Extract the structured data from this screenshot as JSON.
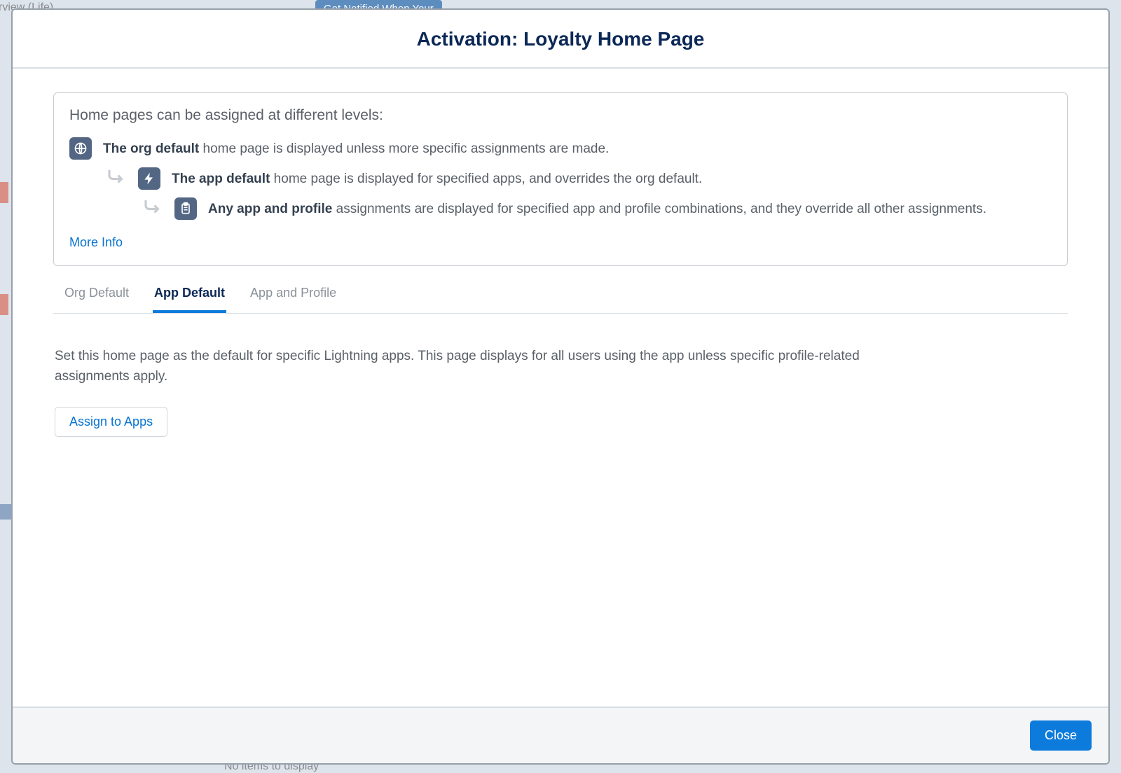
{
  "backdrop": {
    "top_left": "rview (Life)",
    "top_pill": "Get Notified When Your",
    "bottom_center": "No items to display"
  },
  "modal": {
    "title": "Activation: Loyalty Home Page"
  },
  "info": {
    "heading": "Home pages can be assigned at different levels:",
    "levels": [
      {
        "bold": "The org default",
        "rest": " home page is displayed unless more specific assignments are made."
      },
      {
        "bold": "The app default",
        "rest": " home page is displayed for specified apps, and overrides the org default."
      },
      {
        "bold": "Any app and profile",
        "rest": " assignments are displayed for specified app and profile combinations, and they override all other assignments."
      }
    ],
    "more_info": "More Info"
  },
  "tabs": {
    "items": [
      {
        "label": "Org Default"
      },
      {
        "label": "App Default"
      },
      {
        "label": "App and Profile"
      }
    ],
    "active_index": 1
  },
  "content": {
    "description": "Set this home page as the default for specific Lightning apps. This page displays for all users using the app unless specific profile-related assignments apply.",
    "assign_button": "Assign to Apps"
  },
  "footer": {
    "close": "Close"
  }
}
